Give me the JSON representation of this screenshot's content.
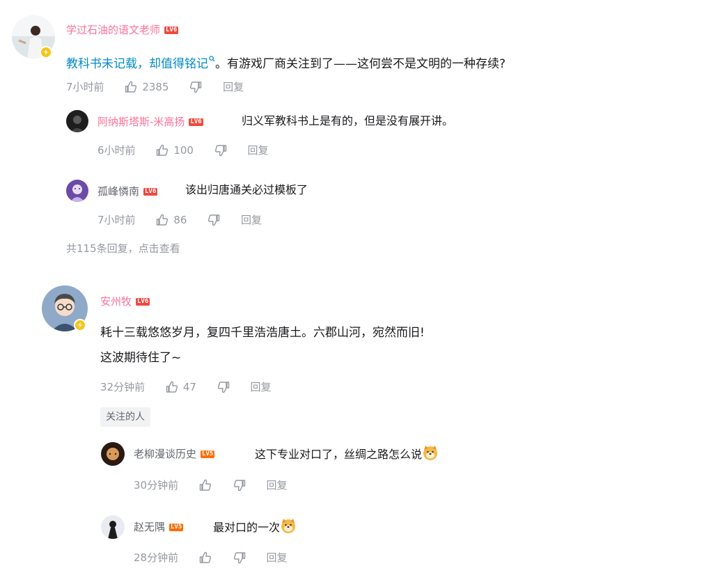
{
  "comments": [
    {
      "username": "学过石油的语文老师",
      "level": "LV6",
      "text_link": "教科书未记载，却值得铭记",
      "text_rest": "。有游戏厂商关注到了——这何尝不是文明的一种存续?",
      "time": "7小时前",
      "likes": "2385",
      "reply_label": "回复",
      "replies": [
        {
          "username": "阿纳斯塔斯-米高扬",
          "level": "LV6",
          "text": "归义军教科书上是有的，但是没有展开讲。",
          "time": "6小时前",
          "likes": "100",
          "reply_label": "回复"
        },
        {
          "username": "孤峰憐南",
          "level": "LV6",
          "text": "该出归唐通关必过模板了",
          "time": "7小时前",
          "likes": "86",
          "reply_label": "回复"
        }
      ],
      "view_more": "共115条回复，点击查看"
    },
    {
      "username": "安州牧",
      "level": "LV6",
      "text_line1": "耗十三载悠悠岁月，复四千里浩浩唐土。六郡山河，宛然而旧!",
      "text_line2": "这波期待住了~",
      "time": "32分钟前",
      "likes": "47",
      "reply_label": "回复",
      "tag": "关注的人",
      "replies": [
        {
          "username": "老柳漫谈历史",
          "level": "LV5",
          "text": "这下专业对口了，丝绸之路怎么说",
          "time": "30分钟前",
          "likes": "",
          "reply_label": "回复"
        },
        {
          "username": "赵无隅",
          "level": "LV5",
          "text": "最对口的一次",
          "time": "28分钟前",
          "likes": "",
          "reply_label": "回复"
        }
      ]
    }
  ],
  "icons": {
    "like": "thumbs-up-icon",
    "dislike": "thumbs-down-icon",
    "search": "search-icon",
    "emoji": "doge-emoji-icon",
    "verified": "lightning-badge-icon"
  },
  "colors": {
    "username_pink": "#fb7299",
    "link_blue": "#008ac5",
    "meta_gray": "#9499a0",
    "level_red": "#f0493e",
    "level_orange": "#ff6c00",
    "verified_yellow": "#f5c518"
  }
}
